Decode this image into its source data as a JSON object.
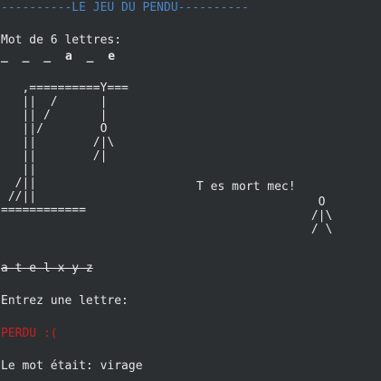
{
  "title": "----------LE JEU DU PENDU----------",
  "word_info": "Mot de 6 lettres:",
  "word_mask": "_ _ _ a _ e",
  "gallows_lines": [
    "   ,==========Y===",
    "   ||  /      |",
    "   || /       |",
    "   ||/        O",
    "   ||        /|\\",
    "   ||        /|",
    "   ||",
    "  /||",
    " //||",
    "============"
  ],
  "death_message": "T es mort mec!",
  "figure_lines": [
    "  O",
    " /|\\",
    " / \\"
  ],
  "used_letters": "a t e l x y z",
  "prompt": "Entrez une lettre:",
  "result": "PERDU :(",
  "answer": "Le mot était: virage"
}
